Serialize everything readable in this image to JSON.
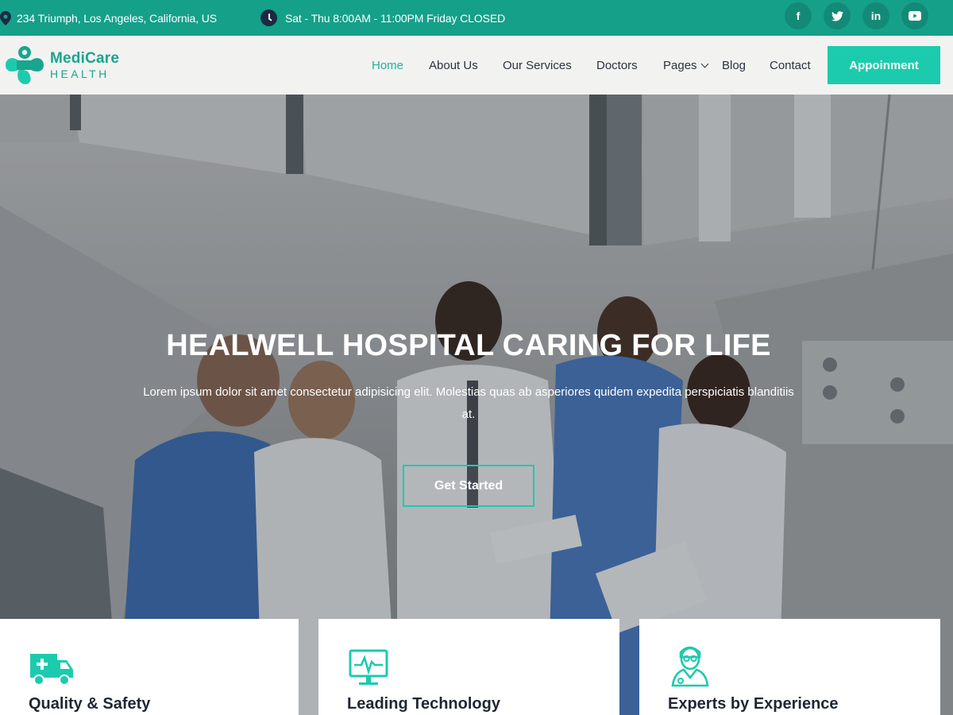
{
  "topbar": {
    "address": "234 Triumph, Los Angeles, California, US",
    "hours": "Sat - Thu 8:00AM - 11:00PM Friday CLOSED",
    "socials": [
      {
        "icon": "facebook-icon",
        "glyph": "f"
      },
      {
        "icon": "twitter-icon",
        "glyph": "t"
      },
      {
        "icon": "linkedin-icon",
        "glyph": "in"
      },
      {
        "icon": "youtube-icon",
        "glyph": "▶"
      }
    ]
  },
  "logo": {
    "line1": "MediCare",
    "line2": "HEALTH"
  },
  "nav": {
    "items": [
      "Home",
      "About Us",
      "Our Services",
      "Doctors",
      "Pages",
      "Blog",
      "Contact"
    ],
    "appointment_label": "Appoinment"
  },
  "hero": {
    "title": "HEALWELL HOSPITAL CARING FOR LIFE",
    "subtitle": "Lorem ipsum dolor sit amet consectetur adipisicing elit. Molestias quas ab asperiores quidem expedita perspiciatis blanditiis at.",
    "cta_label": "Get Started"
  },
  "features": [
    {
      "title": "Quality & Safety",
      "icon": "ambulance-icon"
    },
    {
      "title": "Leading Technology",
      "icon": "monitor-icon"
    },
    {
      "title": "Experts by Experience",
      "icon": "doctor-icon"
    }
  ],
  "colors": {
    "brand": "#1ccbad",
    "topbar": "#15a08a",
    "nav_active": "#20b29c",
    "dark_text": "#1f2733"
  }
}
